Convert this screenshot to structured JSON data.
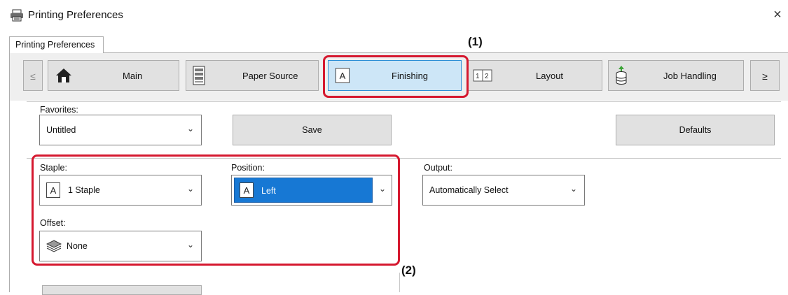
{
  "window": {
    "title": "Printing Preferences",
    "close": "×",
    "outer_tab": "Printing Preferences"
  },
  "tabs": {
    "prev": "≤",
    "next": "≥",
    "items": [
      {
        "label": "Main",
        "icon": "home-icon"
      },
      {
        "label": "Paper Source",
        "icon": "paper-tray-icon"
      },
      {
        "label": "Finishing",
        "icon": "finishing-icon",
        "selected": true
      },
      {
        "label": "Layout",
        "icon": "layout-pages-icon"
      },
      {
        "label": "Job Handling",
        "icon": "job-handling-icon"
      }
    ]
  },
  "favorites": {
    "label": "Favorites:",
    "value": "Untitled",
    "save": "Save",
    "defaults": "Defaults"
  },
  "staple": {
    "label": "Staple:",
    "value": "1 Staple",
    "glyph": "A"
  },
  "position": {
    "label": "Position:",
    "value": "Left",
    "glyph": "A"
  },
  "output": {
    "label": "Output:",
    "value": "Automatically Select"
  },
  "offset": {
    "label": "Offset:",
    "value": "None"
  },
  "annotations": {
    "one": "(1)",
    "two": "(2)"
  },
  "colors": {
    "highlight_red": "#d5182f",
    "selected_blue": "#1778d4",
    "tab_selected": "#cde6f7"
  }
}
